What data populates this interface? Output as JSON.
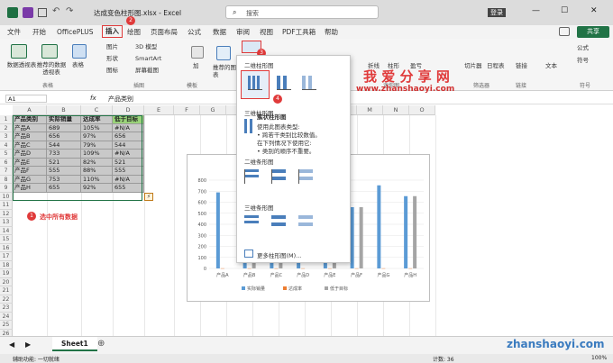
{
  "window": {
    "filename": "达成变色柱形图.xlsx",
    "app": "Excel",
    "separator": "-",
    "search_placeholder": "搜索",
    "login": "登录",
    "badge2": "2"
  },
  "menu": {
    "items": [
      "文件",
      "开始",
      "OfficePLUS",
      "插入",
      "绘图",
      "页面布局",
      "公式",
      "数据",
      "审阅",
      "视图",
      "PDF工具箱",
      "帮助"
    ],
    "share": "共享",
    "badge3": "3"
  },
  "ribbon": {
    "tables": [
      "数据透视表",
      "推荐的数据透视表",
      "表格"
    ],
    "tables_group": "表格",
    "illus": [
      "图片",
      "形状",
      "图标",
      "3D 模型",
      "SmartArt",
      "屏幕截图"
    ],
    "illus_group": "插图",
    "addins": "加",
    "addins_group": "",
    "charts": [
      "推荐的图表",
      "图表"
    ],
    "right": [
      "切片器",
      "日程表",
      "链接",
      "文本",
      "符号"
    ],
    "right_groups": [
      "筛选器",
      "链接",
      "",
      "符号"
    ],
    "extra": [
      "公式",
      "符号"
    ],
    "sparks": "迷你图",
    "sparks_items": [
      "折线",
      "柱形",
      "盈亏"
    ],
    "templates_group": "模板"
  },
  "formula_bar": {
    "cell": "A1",
    "fx": "fx",
    "content": "产品类别"
  },
  "sheet": {
    "columns": [
      "A",
      "B",
      "C",
      "D",
      "E",
      "F",
      "G",
      "H",
      "I",
      "J",
      "K",
      "L",
      "M",
      "N",
      "O"
    ],
    "rows": [
      "1",
      "2",
      "3",
      "4",
      "5",
      "6",
      "7",
      "8",
      "9",
      "10",
      "11",
      "12",
      "13",
      "14",
      "15",
      "16",
      "17",
      "18",
      "19",
      "20",
      "21",
      "22",
      "23",
      "24",
      "25",
      "26"
    ],
    "table_header": [
      "产品类别",
      "实际销量",
      "达成率",
      "低于目标"
    ],
    "table_rows": [
      [
        "产品A",
        "689",
        "105%",
        "#N/A"
      ],
      [
        "产品B",
        "656",
        "97%",
        "656"
      ],
      [
        "产品C",
        "544",
        "79%",
        "544"
      ],
      [
        "产品D",
        "733",
        "109%",
        "#N/A"
      ],
      [
        "产品E",
        "521",
        "82%",
        "521"
      ],
      [
        "产品F",
        "555",
        "88%",
        "555"
      ],
      [
        "产品G",
        "753",
        "110%",
        "#N/A"
      ],
      [
        "产品H",
        "655",
        "92%",
        "655"
      ]
    ],
    "step1_badge": "1",
    "step1_text": "选中所有数据"
  },
  "chart_data": {
    "type": "bar",
    "categories": [
      "产品A",
      "产品B",
      "产品C",
      "产品D",
      "产品E",
      "产品F",
      "产品G",
      "产品H"
    ],
    "series": [
      {
        "name": "实际销量",
        "values": [
          689,
          656,
          544,
          733,
          521,
          555,
          753,
          655
        ],
        "color": "#5b9bd5"
      },
      {
        "name": "达成率",
        "values": [
          1.05,
          0.97,
          0.79,
          1.09,
          0.82,
          0.88,
          1.1,
          0.92
        ],
        "color": "#ed7d31"
      },
      {
        "name": "低于目标",
        "values": [
          null,
          656,
          544,
          null,
          521,
          555,
          null,
          655
        ],
        "color": "#a5a5a5"
      }
    ],
    "ylim": [
      0,
      800
    ],
    "yticks": [
      "0",
      "100",
      "200",
      "300",
      "400",
      "500",
      "600",
      "700",
      "800"
    ]
  },
  "dropdown": {
    "section1": "二维柱形图",
    "section2": "三维柱形图",
    "section3": "二维条形图",
    "section4": "三维条形图",
    "tooltip_title": "簇状柱形图",
    "tooltip_lines": [
      "使用此图表类型:",
      "• 跨若干类别比较数值。",
      "在下列情况下使用它:",
      "• 类别的顺序不重要。"
    ],
    "more": "更多柱形图(M)...",
    "badge4": "4"
  },
  "watermark": {
    "title": "我 爱 分 享 网",
    "url": "www.zhanshaoyi.com",
    "corner": "zhanshaoyi.com"
  },
  "sheet_tabs": {
    "active": "Sheet1"
  },
  "status": {
    "left": "辅助功能: 一切就绪",
    "count_label": "计数: 36",
    "zoom": "100%"
  },
  "colors": {
    "accent": "#217346",
    "red": "#e03a3a",
    "blue": "#5b9bd5",
    "gray": "#a5a5a5"
  }
}
